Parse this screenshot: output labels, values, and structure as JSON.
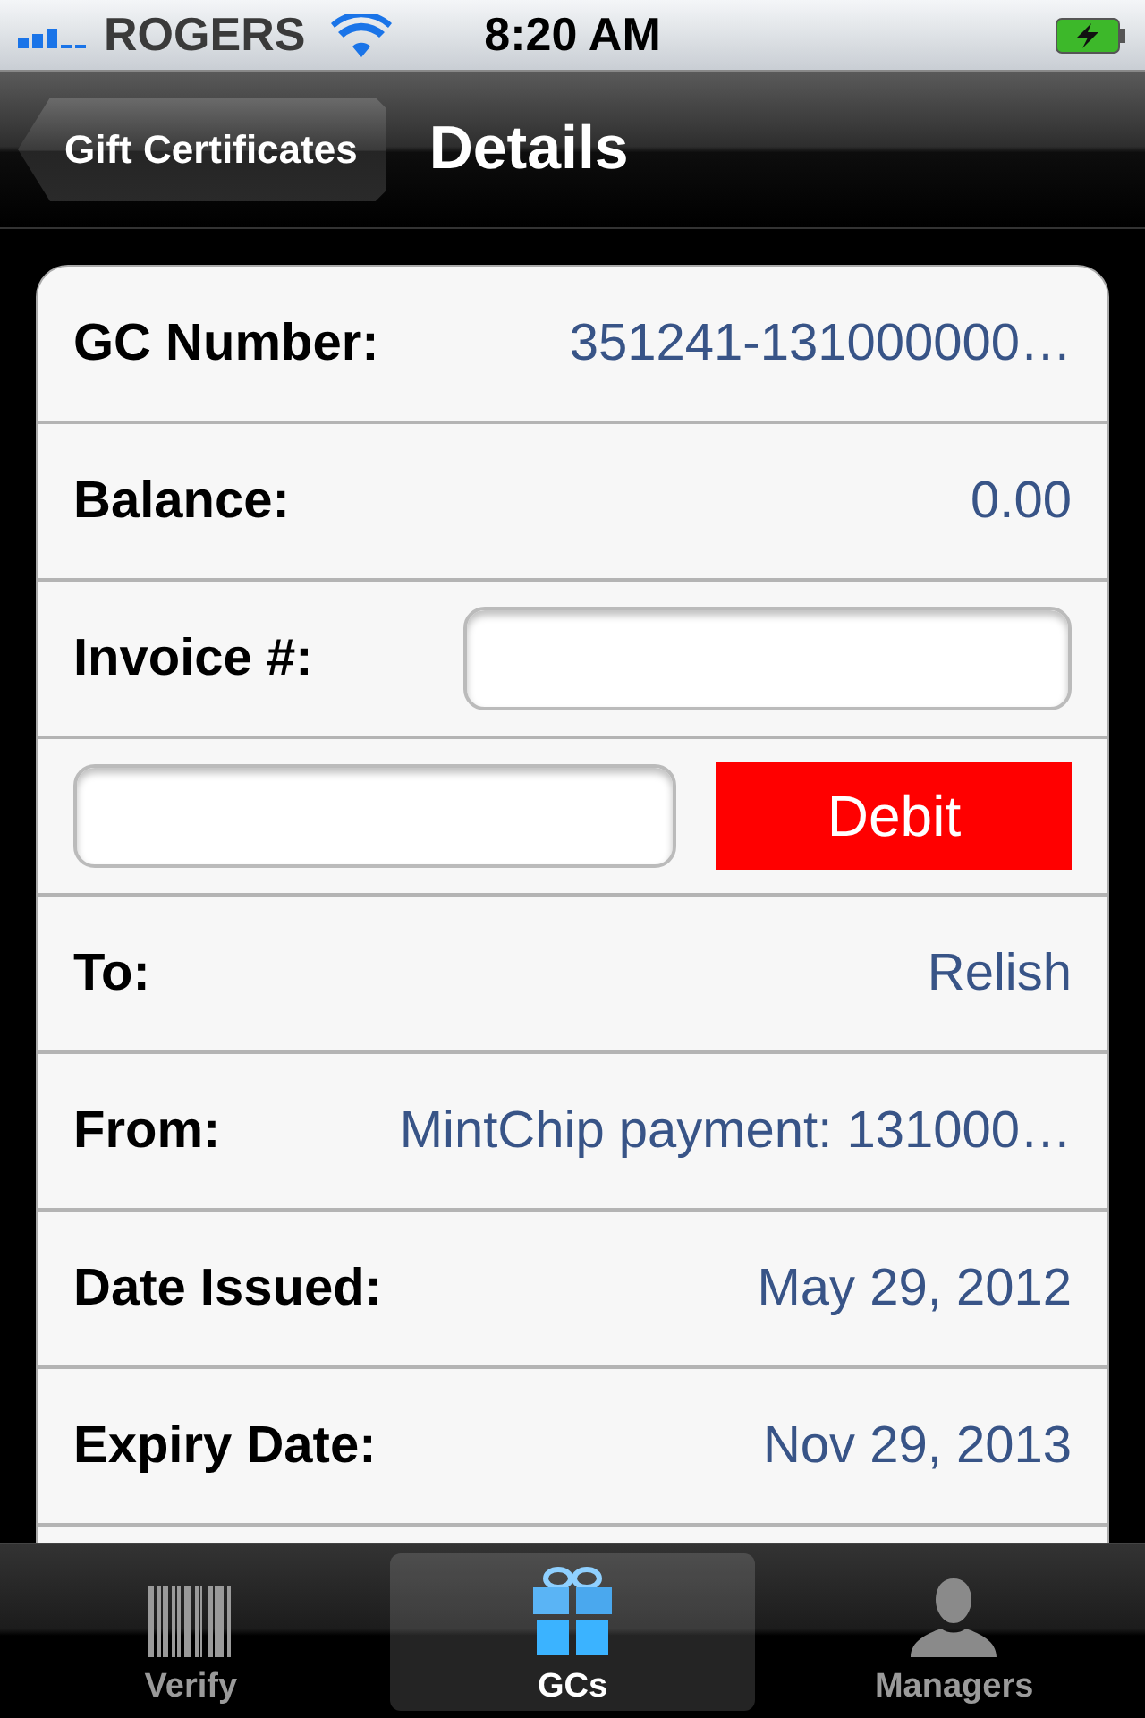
{
  "status_bar": {
    "carrier": "ROGERS",
    "time": "8:20 AM"
  },
  "nav_bar": {
    "back": "Gift Certificates",
    "title": "Details"
  },
  "rows": [
    {
      "kind": "value",
      "label": "GC Number:",
      "value": "351241-131000000…"
    },
    {
      "kind": "value",
      "label": "Balance:",
      "value": "0.00"
    },
    {
      "kind": "input",
      "label": "Invoice #:"
    },
    {
      "kind": "action",
      "button": "Debit"
    },
    {
      "kind": "value",
      "label": "To:",
      "value": "Relish"
    },
    {
      "kind": "value",
      "label": "From:",
      "value": "MintChip payment: 131000…"
    },
    {
      "kind": "value",
      "label": "Date Issued:",
      "value": "May 29, 2012"
    },
    {
      "kind": "value",
      "label": "Expiry Date:",
      "value": "Nov 29, 2013"
    },
    {
      "kind": "empty"
    }
  ],
  "tabs": [
    {
      "label": "Verify",
      "kind": "barcode",
      "selected": false
    },
    {
      "label": "GCs",
      "kind": "gift",
      "selected": true
    },
    {
      "label": "Managers",
      "kind": "person",
      "selected": false
    }
  ]
}
